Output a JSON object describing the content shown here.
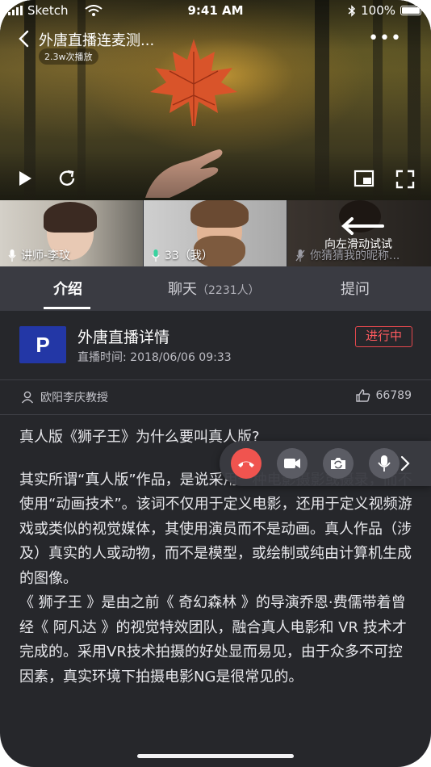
{
  "status": {
    "carrier": "Sketch",
    "time": "9:41 AM",
    "battery": "100%"
  },
  "video": {
    "title": "外唐直播连麦测...",
    "plays": "2.3w次播放",
    "icons": [
      "back-icon",
      "more-icon",
      "play-icon",
      "refresh-icon",
      "pip-icon",
      "fullscreen-icon"
    ]
  },
  "participants": [
    {
      "label": "讲师-李玟",
      "icon": "mic-icon"
    },
    {
      "label": "33（我）",
      "icon": "mic-active-icon"
    },
    {
      "label": "你猜猜我的昵称...",
      "icon": "mic-muted-icon"
    }
  ],
  "swipe_hint": "向左滑动试试",
  "tabs": [
    {
      "label": "介绍",
      "sub": ""
    },
    {
      "label": "聊天",
      "sub": "（2231人）"
    },
    {
      "label": "提问",
      "sub": ""
    }
  ],
  "info": {
    "logo_letter": "P",
    "title": "外唐直播详情",
    "time": "直播时间: 2018/06/06 09:33",
    "badge": "进行中",
    "teacher": "欧阳李庆教授",
    "likes": "66789"
  },
  "article": {
    "heading": "真人版《狮子王》为什么要叫真人版?",
    "p1": "其实所谓“真人版”作品，是说采用一种电影摄影或摄录，而不使用“动画技术”。该词不仅用于定义电影，还用于定义视频游戏或类似的视觉媒体，其使用演员而不是动画。真人作品（涉及）真实的人或动物，而不是模型，或绘制或纯由计算机生成的图像。",
    "p2": "《 狮子王 》是由之前《 奇幻森林 》的导演乔恩·费儒带着曾经《 阿凡达 》的视觉特效团队，融合真人电影和 VR 技术才完成的。采用VR技术拍摄的好处显而易见，由于众多不可控因素，真实环境下拍摄电影NG是很常见的。"
  },
  "colors": {
    "accent_red": "#f0544f",
    "badge_red": "#e5484d",
    "logo_blue": "#2337a6",
    "panel": "#26272b",
    "tabs_bg": "#3a3b42"
  }
}
